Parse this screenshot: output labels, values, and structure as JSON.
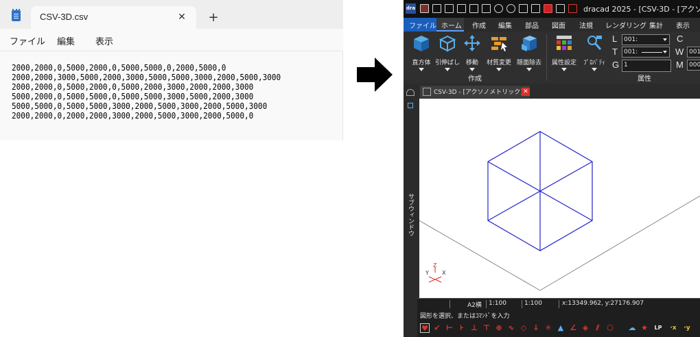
{
  "notepad": {
    "tab_title": "CSV-3D.csv",
    "close_glyph": "✕",
    "new_tab_glyph": "+",
    "menu": [
      "ファイル",
      "編集",
      "表示"
    ],
    "lines": [
      "2000,2000,0,5000,2000,0,5000,5000,0,2000,5000,0",
      "2000,2000,3000,5000,2000,3000,5000,5000,3000,2000,5000,3000",
      "2000,2000,0,5000,2000,0,5000,2000,3000,2000,2000,3000",
      "5000,2000,0,5000,5000,0,5000,5000,3000,5000,2000,3000",
      "5000,5000,0,5000,5000,3000,2000,5000,3000,2000,5000,3000",
      "2000,2000,0,2000,2000,3000,2000,5000,3000,2000,5000,0"
    ]
  },
  "cad": {
    "logo": "dra",
    "title": "dracad 2025 - [CSV-3D - [アクソノ",
    "ribbon_tabs": [
      "ファイル",
      "ホーム",
      "作成",
      "編集",
      "部品",
      "図面",
      "法規",
      "レンダリング",
      "集計",
      "表示"
    ],
    "ribbon_buttons": [
      {
        "label": "直方体",
        "icon": "cube-icon"
      },
      {
        "label": "引伸ばし",
        "icon": "extrude-icon"
      },
      {
        "label": "移動",
        "icon": "move-icon"
      },
      {
        "label": "材質変更",
        "icon": "material-icon"
      },
      {
        "label": "隠面除去",
        "icon": "hidden-surface-icon"
      },
      {
        "label": "属性設定",
        "icon": "attribute-icon"
      },
      {
        "label": "ﾌﾟﾛﾊﾟﾃｨ",
        "icon": "properties-icon"
      }
    ],
    "group_create": "作成",
    "group_attr": "属性",
    "props": {
      "L": "L",
      "T": "T",
      "G": "G",
      "C": "C",
      "W": "W",
      "M": "M",
      "L_value": "001:",
      "T_value": "001:",
      "G_value": "1",
      "W_value": "001",
      "M_value": "000"
    },
    "subwindow_label": "サブウィンドウ",
    "doc_tab_title": "CSV-3D - [アクソノメトリック]",
    "doc_tab_close": "✕",
    "status": {
      "paper": "A2横",
      "scale1": "1:100",
      "scale2": "1:100",
      "coords": "x:13349.962, y:27176.907"
    },
    "prompt": "図形を選択、またはｺﾏﾝﾄﾞを入力",
    "axis": {
      "z": "Z",
      "y": "Y",
      "x": "X"
    },
    "colors": {
      "model_lines": "#2222cc",
      "ground_lines": "#888888",
      "axis": "#dd2222"
    }
  }
}
